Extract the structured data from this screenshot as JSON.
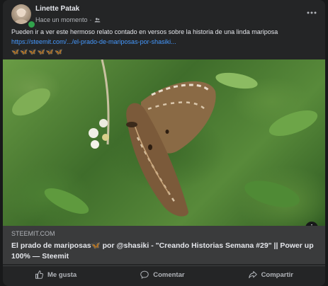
{
  "post": {
    "author": "Linette Patak",
    "time": "Hace un momento",
    "separator": "·",
    "text": "Pueden ir a ver este hermoso relato contado en versos sobre la historia de una linda mariposa",
    "link_text": "https://steemit.com/.../el-prado-de-mariposas-por-shasiki...",
    "emojis": "🦋🦋🦋🦋🦋🦋"
  },
  "link_preview": {
    "domain": "STEEMIT.COM",
    "title": "El prado de mariposas🦋 por @shasiki - \"Creando Historias Semana #29\" || Power up 100% — Steemit"
  },
  "actions": {
    "like": "Me gusta",
    "comment": "Comentar",
    "share": "Compartir"
  },
  "icons": {
    "audience": "friends-icon",
    "more": "more-icon",
    "info": "info-icon",
    "like": "thumbs-up-icon",
    "comment": "comment-icon",
    "share": "share-icon"
  },
  "colors": {
    "background": "#18191a",
    "card": "#242526",
    "link": "#4599ff",
    "online": "#31a24c"
  }
}
